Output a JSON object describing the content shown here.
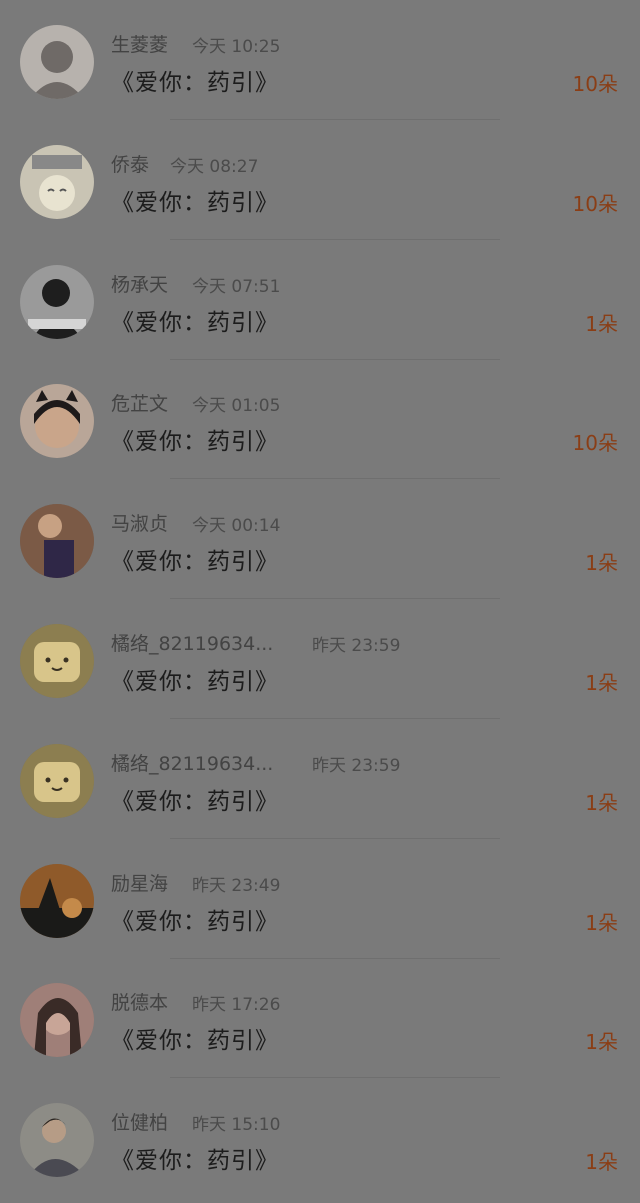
{
  "items": [
    {
      "name": "生菱菱",
      "time": "今天 10:25",
      "title": "《爱你：药引》",
      "flowers": "10朵",
      "avatar": "photo-avatar-icon",
      "colors": [
        "#b7b2ad",
        "#6f6a67"
      ]
    },
    {
      "name": "侨泰",
      "time": "今天 08:27",
      "title": "《爱你：药引》",
      "flowers": "10朵",
      "avatar": "cartoon-avatar-icon",
      "colors": [
        "#c9c4b4",
        "#e8e3d0"
      ]
    },
    {
      "name": "杨承天",
      "time": "今天 07:51",
      "title": "《爱你：药引》",
      "flowers": "1朵",
      "avatar": "bw-avatar-icon",
      "colors": [
        "#9a9a9a",
        "#1e1e1e"
      ]
    },
    {
      "name": "危芷文",
      "time": "今天 01:05",
      "title": "《爱你：药引》",
      "flowers": "10朵",
      "avatar": "girl-avatar-icon",
      "colors": [
        "#b9a698",
        "#1e1a1a"
      ]
    },
    {
      "name": "马淑贞",
      "time": "今天 00:14",
      "title": "《爱你：药引》",
      "flowers": "1朵",
      "avatar": "fist-avatar-icon",
      "colors": [
        "#7b5a46",
        "#2f2747"
      ]
    },
    {
      "name": "橘络_82119634...",
      "time": "昨天 23:59",
      "title": "《爱你：药引》",
      "flowers": "1朵",
      "avatar": "bread-avatar-icon",
      "colors": [
        "#8c7e50",
        "#d8c58a"
      ]
    },
    {
      "name": "橘络_82119634...",
      "time": "昨天 23:59",
      "title": "《爱你：药引》",
      "flowers": "1朵",
      "avatar": "bread-avatar-icon",
      "colors": [
        "#8c7e50",
        "#d8c58a"
      ]
    },
    {
      "name": "励星海",
      "time": "昨天 23:49",
      "title": "《爱你：药引》",
      "flowers": "1朵",
      "avatar": "sunset-avatar-icon",
      "colors": [
        "#8f5a2a",
        "#1a1a18"
      ]
    },
    {
      "name": "脱德本",
      "time": "昨天 17:26",
      "title": "《爱你：药引》",
      "flowers": "1朵",
      "avatar": "portrait-avatar-icon",
      "colors": [
        "#9f7f78",
        "#3a2b27"
      ]
    },
    {
      "name": "位健柏",
      "time": "昨天 15:10",
      "title": "《爱你：药引》",
      "flowers": "1朵",
      "avatar": "man-avatar-icon",
      "colors": [
        "#8d8c86",
        "#2a2622"
      ]
    }
  ]
}
